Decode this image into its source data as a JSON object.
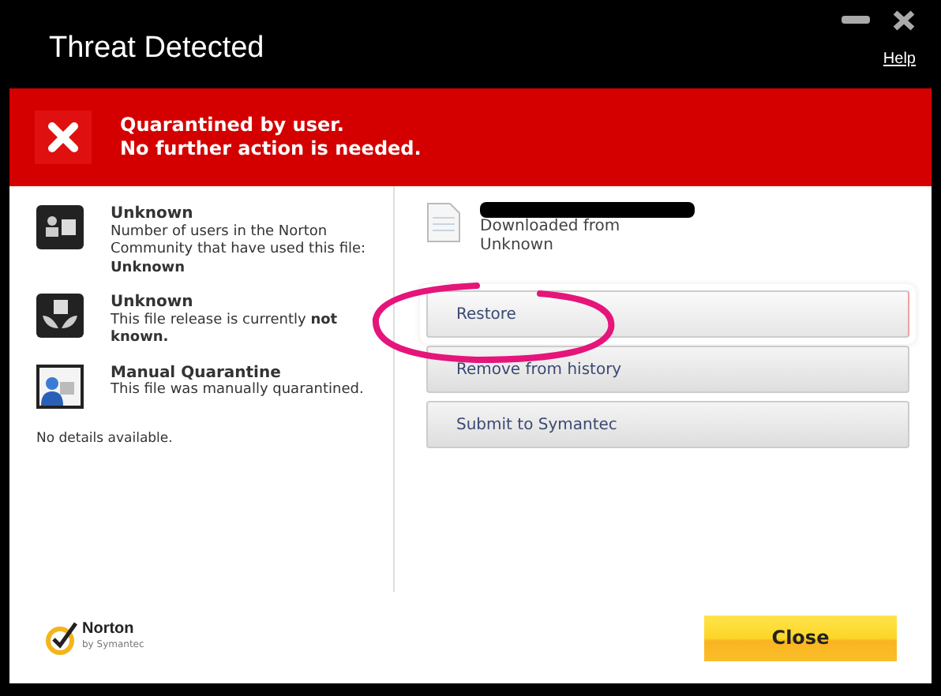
{
  "window": {
    "title": "Threat Detected",
    "help_link": "Help"
  },
  "banner": {
    "message_lines": [
      "Quarantined by user.",
      "No further action is needed."
    ]
  },
  "details": [
    {
      "kind": "community",
      "title": "Unknown",
      "description": "Number of users in the Norton Community that have used this file: **Unknown**"
    },
    {
      "kind": "release",
      "title": "Unknown",
      "description": "This file release is currently **not known.**"
    },
    {
      "kind": "quarantine",
      "title": "Manual Quarantine",
      "description": "This file was manually quarantined."
    }
  ],
  "details_note": "No details available.",
  "file": {
    "origin_lines": [
      "Downloaded from",
      "Unknown"
    ]
  },
  "actions": [
    {
      "label": "Restore",
      "selected": true
    },
    {
      "label": "Remove from history",
      "selected": false
    },
    {
      "label": "Submit to Symantec",
      "selected": false
    }
  ],
  "logo": {
    "name": "Norton",
    "byline": "by Symantec"
  },
  "close_button": "Close"
}
